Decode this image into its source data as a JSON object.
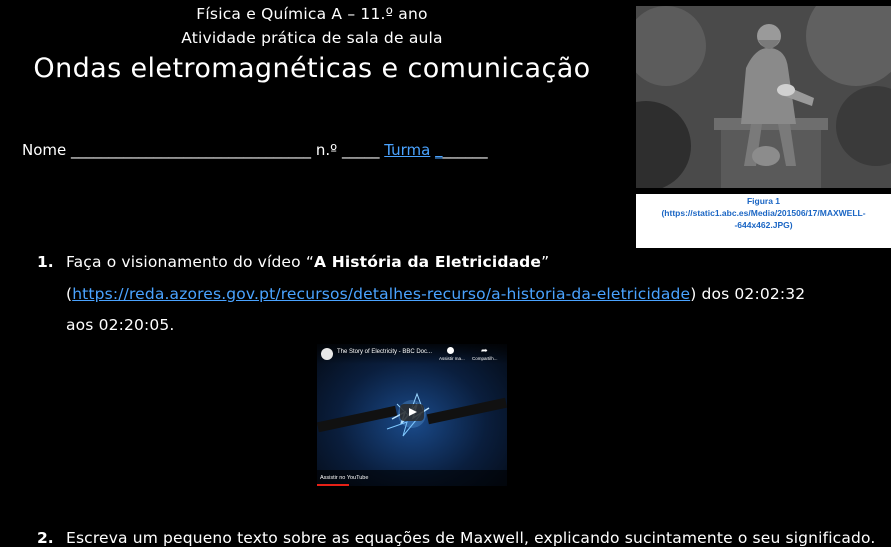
{
  "header": {
    "subject": "Física e Química A – 11.º ano",
    "activity": "Atividade prática de sala de aula",
    "title": "Ondas eletromagnéticas e comunicação"
  },
  "student_line": {
    "name_label": "Nome",
    "name_blank": "________________________________",
    "number_label": "n.º",
    "number_blank": "_____",
    "class_label": "Turma",
    "class_link_blank": "_",
    "class_blank": "______"
  },
  "figure": {
    "label": "Figura 1",
    "source": "(https://static1.abc.es/Media/201506/17/MAXWELL--644x462.JPG)"
  },
  "question1": {
    "number": "1.",
    "text_a": "Faça o visionamento do vídeo “",
    "video_title": "A História da Eletricidade",
    "text_b": "”",
    "paren_open": "(",
    "url": "https://reda.azores.gov.pt/recursos/detalhes-recurso/a-historia-da-eletricidade",
    "text_c": ") dos 02:02:32",
    "text_d": "aos 02:20:05."
  },
  "video_thumb": {
    "title": "The Story of Electricity - BBC Doc...",
    "watch_later": "Assistir ma...",
    "share": "Compartilh...",
    "watch_on": "Assistir no",
    "platform": "YouTube"
  },
  "question2": {
    "number": "2.",
    "text": "Escreva um pequeno texto sobre as equações de Maxwell, explicando sucintamente o seu significado."
  }
}
